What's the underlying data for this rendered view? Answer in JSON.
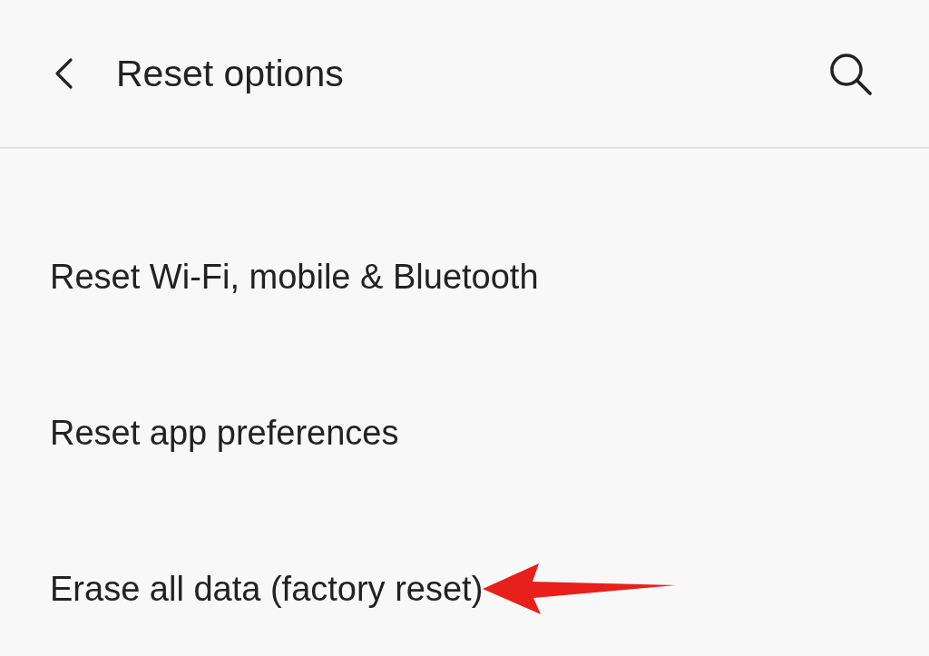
{
  "header": {
    "title": "Reset options"
  },
  "items": [
    {
      "label": "Reset Wi-Fi, mobile & Bluetooth",
      "annotated": false
    },
    {
      "label": "Reset app preferences",
      "annotated": false
    },
    {
      "label": "Erase all data (factory reset)",
      "annotated": true
    }
  ]
}
